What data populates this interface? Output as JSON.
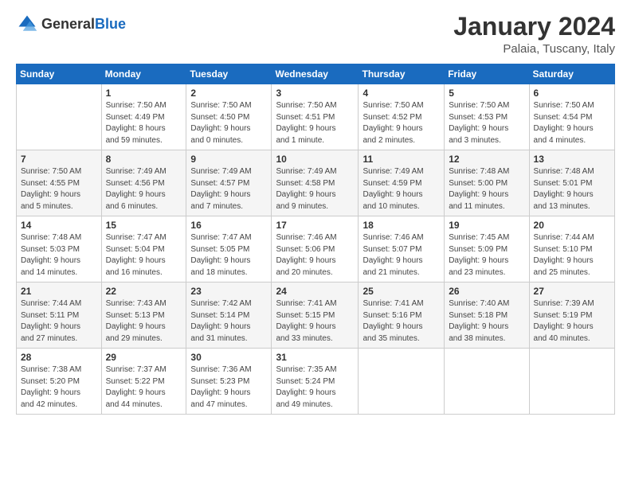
{
  "header": {
    "logo_general": "General",
    "logo_blue": "Blue",
    "main_title": "January 2024",
    "subtitle": "Palaia, Tuscany, Italy"
  },
  "calendar": {
    "days_of_week": [
      "Sunday",
      "Monday",
      "Tuesday",
      "Wednesday",
      "Thursday",
      "Friday",
      "Saturday"
    ],
    "weeks": [
      [
        {
          "day": "",
          "info": ""
        },
        {
          "day": "1",
          "info": "Sunrise: 7:50 AM\nSunset: 4:49 PM\nDaylight: 8 hours\nand 59 minutes."
        },
        {
          "day": "2",
          "info": "Sunrise: 7:50 AM\nSunset: 4:50 PM\nDaylight: 9 hours\nand 0 minutes."
        },
        {
          "day": "3",
          "info": "Sunrise: 7:50 AM\nSunset: 4:51 PM\nDaylight: 9 hours\nand 1 minute."
        },
        {
          "day": "4",
          "info": "Sunrise: 7:50 AM\nSunset: 4:52 PM\nDaylight: 9 hours\nand 2 minutes."
        },
        {
          "day": "5",
          "info": "Sunrise: 7:50 AM\nSunset: 4:53 PM\nDaylight: 9 hours\nand 3 minutes."
        },
        {
          "day": "6",
          "info": "Sunrise: 7:50 AM\nSunset: 4:54 PM\nDaylight: 9 hours\nand 4 minutes."
        }
      ],
      [
        {
          "day": "7",
          "info": "Sunrise: 7:50 AM\nSunset: 4:55 PM\nDaylight: 9 hours\nand 5 minutes."
        },
        {
          "day": "8",
          "info": "Sunrise: 7:49 AM\nSunset: 4:56 PM\nDaylight: 9 hours\nand 6 minutes."
        },
        {
          "day": "9",
          "info": "Sunrise: 7:49 AM\nSunset: 4:57 PM\nDaylight: 9 hours\nand 7 minutes."
        },
        {
          "day": "10",
          "info": "Sunrise: 7:49 AM\nSunset: 4:58 PM\nDaylight: 9 hours\nand 9 minutes."
        },
        {
          "day": "11",
          "info": "Sunrise: 7:49 AM\nSunset: 4:59 PM\nDaylight: 9 hours\nand 10 minutes."
        },
        {
          "day": "12",
          "info": "Sunrise: 7:48 AM\nSunset: 5:00 PM\nDaylight: 9 hours\nand 11 minutes."
        },
        {
          "day": "13",
          "info": "Sunrise: 7:48 AM\nSunset: 5:01 PM\nDaylight: 9 hours\nand 13 minutes."
        }
      ],
      [
        {
          "day": "14",
          "info": "Sunrise: 7:48 AM\nSunset: 5:03 PM\nDaylight: 9 hours\nand 14 minutes."
        },
        {
          "day": "15",
          "info": "Sunrise: 7:47 AM\nSunset: 5:04 PM\nDaylight: 9 hours\nand 16 minutes."
        },
        {
          "day": "16",
          "info": "Sunrise: 7:47 AM\nSunset: 5:05 PM\nDaylight: 9 hours\nand 18 minutes."
        },
        {
          "day": "17",
          "info": "Sunrise: 7:46 AM\nSunset: 5:06 PM\nDaylight: 9 hours\nand 20 minutes."
        },
        {
          "day": "18",
          "info": "Sunrise: 7:46 AM\nSunset: 5:07 PM\nDaylight: 9 hours\nand 21 minutes."
        },
        {
          "day": "19",
          "info": "Sunrise: 7:45 AM\nSunset: 5:09 PM\nDaylight: 9 hours\nand 23 minutes."
        },
        {
          "day": "20",
          "info": "Sunrise: 7:44 AM\nSunset: 5:10 PM\nDaylight: 9 hours\nand 25 minutes."
        }
      ],
      [
        {
          "day": "21",
          "info": "Sunrise: 7:44 AM\nSunset: 5:11 PM\nDaylight: 9 hours\nand 27 minutes."
        },
        {
          "day": "22",
          "info": "Sunrise: 7:43 AM\nSunset: 5:13 PM\nDaylight: 9 hours\nand 29 minutes."
        },
        {
          "day": "23",
          "info": "Sunrise: 7:42 AM\nSunset: 5:14 PM\nDaylight: 9 hours\nand 31 minutes."
        },
        {
          "day": "24",
          "info": "Sunrise: 7:41 AM\nSunset: 5:15 PM\nDaylight: 9 hours\nand 33 minutes."
        },
        {
          "day": "25",
          "info": "Sunrise: 7:41 AM\nSunset: 5:16 PM\nDaylight: 9 hours\nand 35 minutes."
        },
        {
          "day": "26",
          "info": "Sunrise: 7:40 AM\nSunset: 5:18 PM\nDaylight: 9 hours\nand 38 minutes."
        },
        {
          "day": "27",
          "info": "Sunrise: 7:39 AM\nSunset: 5:19 PM\nDaylight: 9 hours\nand 40 minutes."
        }
      ],
      [
        {
          "day": "28",
          "info": "Sunrise: 7:38 AM\nSunset: 5:20 PM\nDaylight: 9 hours\nand 42 minutes."
        },
        {
          "day": "29",
          "info": "Sunrise: 7:37 AM\nSunset: 5:22 PM\nDaylight: 9 hours\nand 44 minutes."
        },
        {
          "day": "30",
          "info": "Sunrise: 7:36 AM\nSunset: 5:23 PM\nDaylight: 9 hours\nand 47 minutes."
        },
        {
          "day": "31",
          "info": "Sunrise: 7:35 AM\nSunset: 5:24 PM\nDaylight: 9 hours\nand 49 minutes."
        },
        {
          "day": "",
          "info": ""
        },
        {
          "day": "",
          "info": ""
        },
        {
          "day": "",
          "info": ""
        }
      ]
    ]
  }
}
